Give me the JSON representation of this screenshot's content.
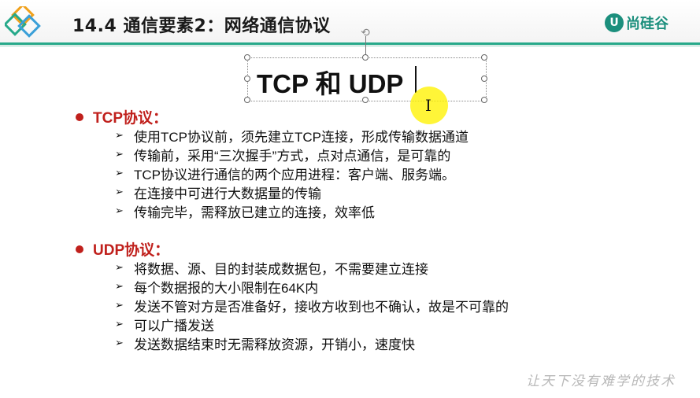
{
  "header": {
    "title": "14.4 通信要素2：网络通信协议",
    "brand_mark": "U",
    "brand_text": "尚硅谷"
  },
  "textbox": {
    "text": "TCP 和 UDP"
  },
  "tcp": {
    "heading": "TCP协议：",
    "items": [
      "使用TCP协议前，须先建立TCP连接，形成传输数据通道",
      "传输前，采用“三次握手”方式，点对点通信，是可靠的",
      "TCP协议进行通信的两个应用进程：客户端、服务端。",
      "在连接中可进行大数据量的传输",
      "传输完毕，需释放已建立的连接，效率低"
    ]
  },
  "udp": {
    "heading": "UDP协议：",
    "items": [
      "将数据、源、目的封装成数据包，不需要建立连接",
      "每个数据报的大小限制在64K内",
      "发送不管对方是否准备好，接收方收到也不确认，故是不可靠的",
      "可以广播发送",
      "发送数据结束时无需释放资源，开销小，速度快"
    ]
  },
  "watermark": "让天下没有难学的技术",
  "icons": {
    "bullet": "red-dot-icon",
    "list_marker": "arrow-right-icon",
    "cursor": "text-cursor-icon",
    "rotate": "rotate-handle-icon"
  },
  "colors": {
    "accent": "#27a98a",
    "brand": "#1c8f7d",
    "section_heading": "#c0201c",
    "cursor_highlight": "#fff200"
  }
}
